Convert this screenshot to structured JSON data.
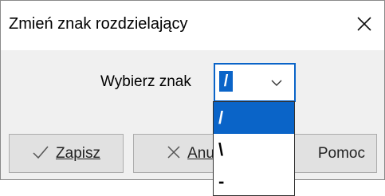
{
  "dialog": {
    "title": "Zmień znak rozdzielający",
    "close_glyph": "✕"
  },
  "prompt": {
    "label": "Wybierz znak"
  },
  "select": {
    "value": "/",
    "options": [
      "/",
      "\\",
      "-"
    ],
    "selected_index": 0,
    "accent_color": "#0a64c8"
  },
  "buttons": {
    "save": {
      "label": "Zapisz",
      "icon": "checkmark-icon"
    },
    "cancel": {
      "label": "Anu",
      "icon": "close-icon"
    },
    "help": {
      "label": "Pomoc"
    }
  }
}
